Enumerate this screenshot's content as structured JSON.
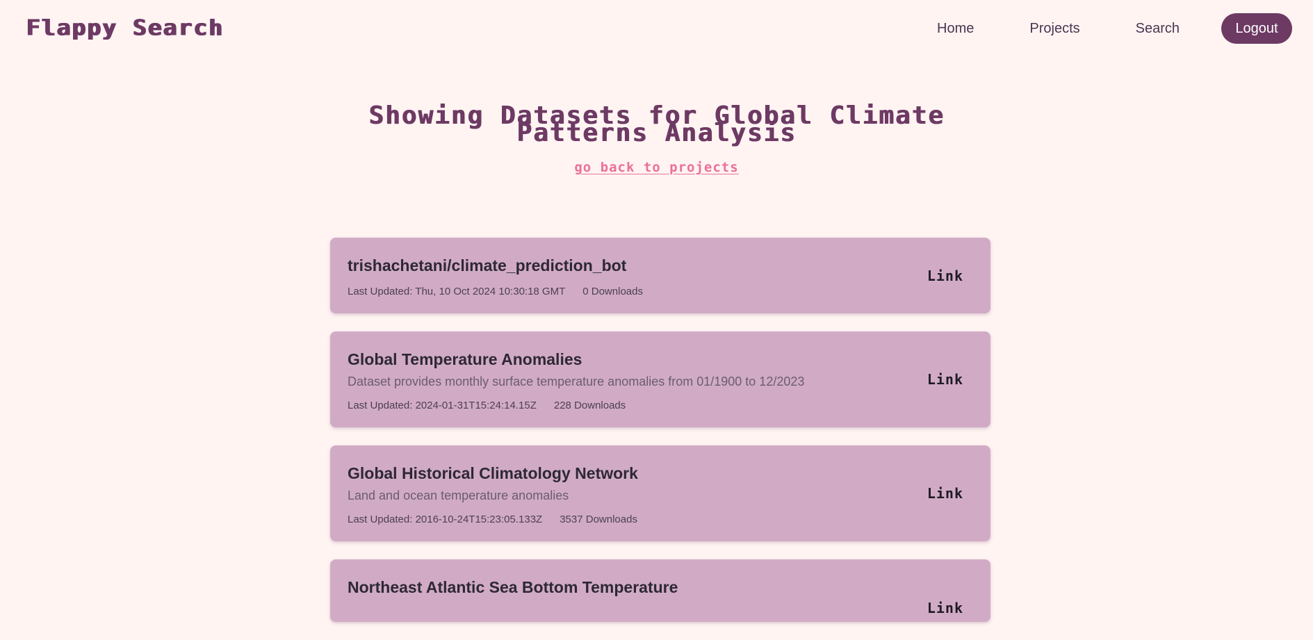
{
  "brand": "Flappy Search",
  "nav": {
    "home": "Home",
    "projects": "Projects",
    "search": "Search",
    "logout": "Logout"
  },
  "page": {
    "title": "Showing Datasets for Global Climate Patterns Analysis",
    "back_link": "go back to projects"
  },
  "datasets": [
    {
      "title": "trishachetani/climate_prediction_bot",
      "description": "",
      "last_updated": "Last Updated: Thu, 10 Oct 2024 10:30:18 GMT",
      "downloads": "0 Downloads",
      "link_label": "Link"
    },
    {
      "title": "Global Temperature Anomalies",
      "description": "Dataset provides monthly surface temperature anomalies from 01/1900 to 12/2023",
      "last_updated": "Last Updated: 2024-01-31T15:24:14.15Z",
      "downloads": "228 Downloads",
      "link_label": "Link"
    },
    {
      "title": "Global Historical Climatology Network",
      "description": "Land and ocean temperature anomalies",
      "last_updated": "Last Updated: 2016-10-24T15:23:05.133Z",
      "downloads": "3537 Downloads",
      "link_label": "Link"
    },
    {
      "title": "Northeast Atlantic Sea Bottom Temperature",
      "link_label": "Link"
    }
  ],
  "colors": {
    "background": "#fff4f2",
    "brand": "#6d3a64",
    "card": "#d1abc6",
    "back_link": "#ec6f9a"
  }
}
